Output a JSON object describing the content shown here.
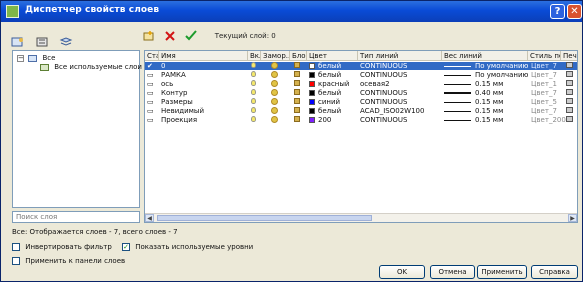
{
  "window": {
    "title": "Диспетчер свойств слоев",
    "help_button": "?",
    "close_button": "✕"
  },
  "toolbar": {
    "current_layer_label": "Текущий слой: 0"
  },
  "tree": {
    "root": "Все",
    "child": "Все используемые слои",
    "search_placeholder": "Поиск слоя"
  },
  "table": {
    "columns": [
      "Ста...",
      "Имя",
      "Вкл",
      "Замор...",
      "Блок...",
      "Цвет",
      "Тип линий",
      "Вес линий",
      "Стиль печ...",
      "Печ..."
    ],
    "rows": [
      {
        "name": "0",
        "color_name": "белый",
        "color_hex": "#ffffff",
        "linetype": "CONTINUOUS",
        "lineweight": "По умолчанию",
        "plot_style": "Цвет_7",
        "selected": true
      },
      {
        "name": "РАМКА",
        "color_name": "белый",
        "color_hex": "#ffffff",
        "linetype": "CONTINUOUS",
        "lineweight": "По умолчанию",
        "plot_style": "Цвет_7",
        "selected": false
      },
      {
        "name": "ось",
        "color_name": "красный",
        "color_hex": "#ff0000",
        "linetype": "осевая2",
        "lineweight": "0.15 мм",
        "plot_style": "Цвет_1",
        "selected": false
      },
      {
        "name": "Контур",
        "color_name": "белый",
        "color_hex": "#ffffff",
        "linetype": "CONTINUOUS",
        "lineweight": "0.40 мм",
        "plot_style": "Цвет_7",
        "selected": false
      },
      {
        "name": "Размеры",
        "color_name": "синий",
        "color_hex": "#0000ff",
        "linetype": "CONTINUOUS",
        "lineweight": "0.15 мм",
        "plot_style": "Цвет_5",
        "selected": false
      },
      {
        "name": "Невидимый",
        "color_name": "белый",
        "color_hex": "#ffffff",
        "linetype": "ACAD_ISO02W100",
        "lineweight": "0.15 мм",
        "plot_style": "Цвет_7",
        "selected": false
      },
      {
        "name": "Проекция",
        "color_name": "200",
        "color_hex": "#7f1fff",
        "linetype": "CONTINUOUS",
        "lineweight": "0.15 мм",
        "plot_style": "Цвет_200",
        "selected": false
      }
    ]
  },
  "status_text": "Все: Отображается слоев - 7, всего слоев - 7",
  "options": {
    "invert_filter": "Инвертировать фильтр",
    "show_used_layers": "Показать используемые уровни",
    "apply_to_toolbar": "Применить к панели слоев"
  },
  "buttons": {
    "ok": "OK",
    "cancel": "Отмена",
    "apply": "Применить",
    "help": "Справка"
  },
  "icons": {
    "new_layer": "new-layer-icon",
    "delete_layer": "delete-layer-icon",
    "set_current": "set-current-icon"
  }
}
